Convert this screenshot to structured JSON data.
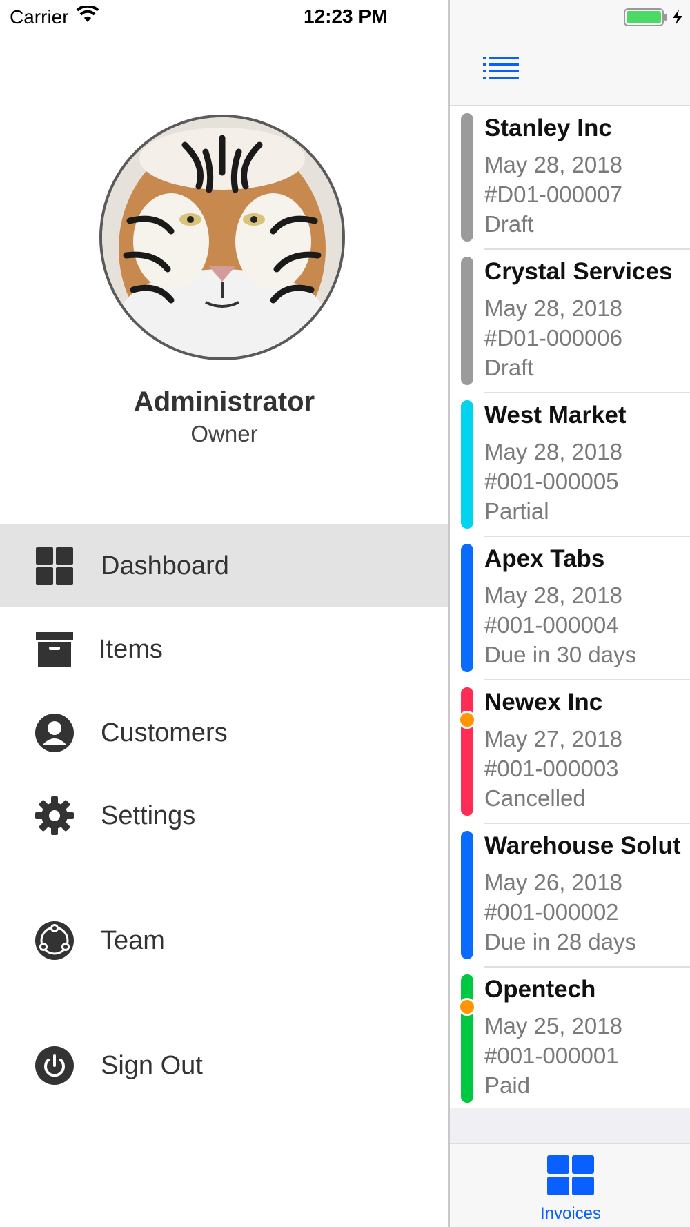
{
  "status_bar": {
    "carrier": "Carrier",
    "time": "12:23 PM"
  },
  "profile": {
    "name": "Administrator",
    "role": "Owner"
  },
  "menu": [
    {
      "label": "Dashboard",
      "icon": "dashboard-icon",
      "active": true
    },
    {
      "label": "Items",
      "icon": "archive-box-icon"
    },
    {
      "label": "Customers",
      "icon": "user-circle-icon"
    },
    {
      "label": "Settings",
      "icon": "gear-icon"
    },
    {
      "label": "Team",
      "icon": "team-icon"
    },
    {
      "label": "Sign Out",
      "icon": "power-icon"
    }
  ],
  "invoices": [
    {
      "customer": "Stanley Inc",
      "date": "May 28, 2018",
      "number": "#D01-000007",
      "status": "Draft",
      "color": "#9b9b9b",
      "dot": false
    },
    {
      "customer": "Crystal Services",
      "date": "May 28, 2018",
      "number": "#D01-000006",
      "status": "Draft",
      "color": "#9b9b9b",
      "dot": false
    },
    {
      "customer": "West Market",
      "date": "May 28, 2018",
      "number": "#001-000005",
      "status": "Partial",
      "color": "#00d4ee",
      "dot": false
    },
    {
      "customer": "Apex Tabs",
      "date": "May 28, 2018",
      "number": "#001-000004",
      "status": "Due in 30 days",
      "color": "#0a6cff",
      "dot": false
    },
    {
      "customer": "Newex Inc",
      "date": "May 27, 2018",
      "number": "#001-000003",
      "status": "Cancelled",
      "color": "#ff2d55",
      "dot": true
    },
    {
      "customer": "Warehouse Solut",
      "date": "May 26, 2018",
      "number": "#001-000002",
      "status": "Due in 28 days",
      "color": "#0a6cff",
      "dot": false
    },
    {
      "customer": "Opentech",
      "date": "May 25, 2018",
      "number": "#001-000001",
      "status": "Paid",
      "color": "#00c840",
      "dot": true
    }
  ],
  "tabbar": {
    "tab_label": "Invoices",
    "tab_icon": "invoices-grid-icon"
  },
  "colors": {
    "accent": "#0a60ff",
    "dot_accent": "#ff9500",
    "battery": "#4cd964"
  }
}
